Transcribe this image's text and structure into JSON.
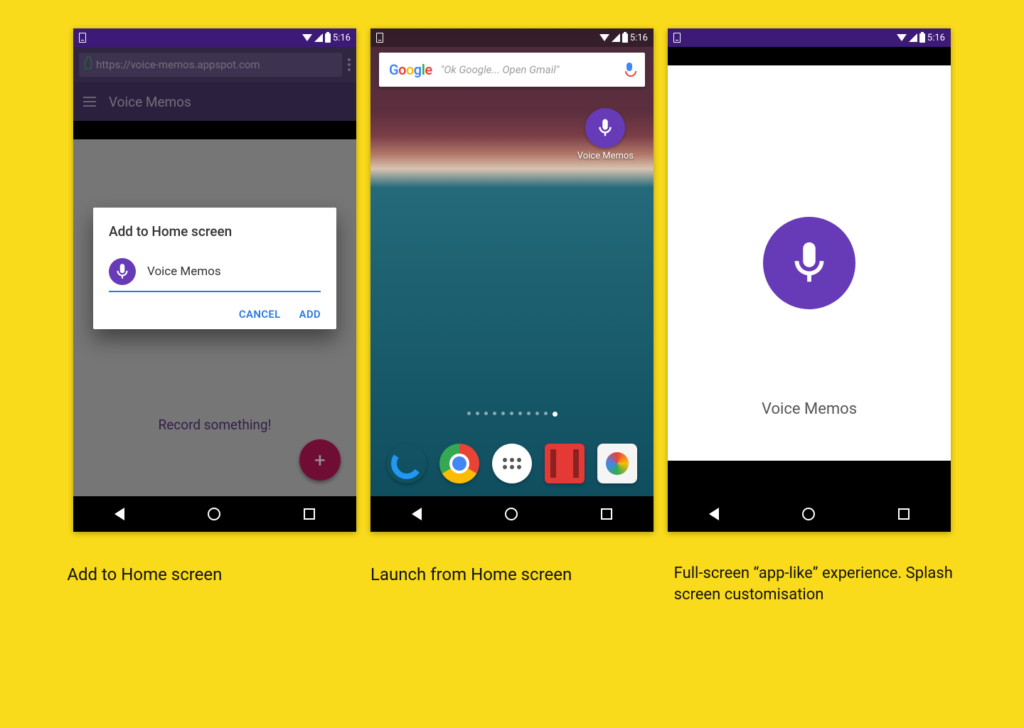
{
  "status": {
    "time": "5:16"
  },
  "phone1": {
    "url": "https://voice-memos.appspot.com",
    "app_title": "Voice Memos",
    "record_prompt": "Record something!",
    "dialog": {
      "title": "Add to Home screen",
      "input_value": "Voice Memos",
      "cancel": "CANCEL",
      "add": "ADD"
    },
    "caption": "Add to Home screen"
  },
  "phone2": {
    "search_placeholder": "\"Ok Google... Open Gmail\"",
    "shortcut_label": "Voice Memos",
    "caption": "Launch from Home screen"
  },
  "phone3": {
    "splash_title": "Voice Memos",
    "caption": "Full-screen “app-like” experience. Splash screen customisation"
  }
}
